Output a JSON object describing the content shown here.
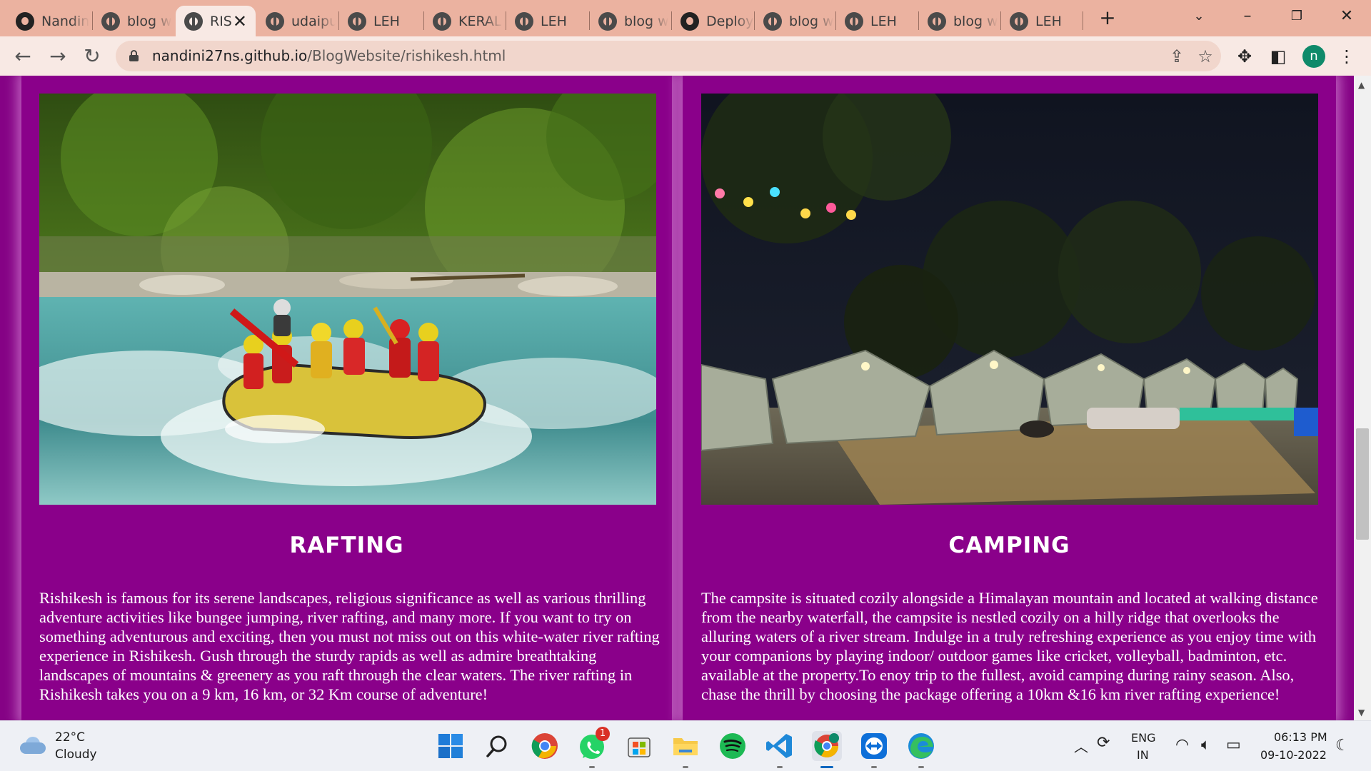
{
  "browser": {
    "tabs": [
      {
        "title": "Nandini",
        "icon": "github-icon"
      },
      {
        "title": "blog w",
        "icon": "globe-icon"
      },
      {
        "title": "RIS",
        "icon": "globe-icon",
        "active": true
      },
      {
        "title": "udaipu",
        "icon": "globe-icon"
      },
      {
        "title": "LEH",
        "icon": "globe-icon"
      },
      {
        "title": "KERAL",
        "icon": "globe-icon"
      },
      {
        "title": "LEH",
        "icon": "globe-icon"
      },
      {
        "title": "blog w",
        "icon": "globe-icon"
      },
      {
        "title": "Deploy",
        "icon": "github-icon"
      },
      {
        "title": "blog w",
        "icon": "globe-icon"
      },
      {
        "title": "LEH",
        "icon": "globe-icon"
      },
      {
        "title": "blog w",
        "icon": "globe-icon"
      },
      {
        "title": "LEH",
        "icon": "globe-icon"
      }
    ],
    "new_tab": "+",
    "url_host": "nandini27ns.github.io",
    "url_path": "/BlogWebsite/rishikesh.html",
    "profile_initial": "n",
    "colors": {
      "tabstrip": "#ebb2a0",
      "active_tab": "#f8e9e4",
      "omnibox": "#f1d6cc"
    }
  },
  "page": {
    "colors": {
      "background": "#850385",
      "card": "#8a008a",
      "glow": "#eca8ec"
    },
    "cards": [
      {
        "heading": "RAFTING",
        "text": "Rishikesh is famous for its serene landscapes, religious significance as well as various thrilling adventure activities like bungee jumping, river rafting, and many more. If you want to try on something adventurous and exciting, then you must not miss out on this white-water river rafting experience in Rishikesh. Gush through the sturdy rapids as well as admire breathtaking landscapes of mountains & greenery as you raft through the clear waters. The river rafting in Rishikesh takes you on a 9 km, 16 km, or 32 Km course of adventure!"
      },
      {
        "heading": "CAMPING",
        "text": "The campsite is situated cozily alongside a Himalayan mountain and located at walking distance from the nearby waterfall, the campsite is nestled cozily on a hilly ridge that overlooks the alluring waters of a river stream. Indulge in a truly refreshing experience as you enjoy time with your companions by playing indoor/ outdoor games like cricket, volleyball, badminton, etc. available at the property.To enoy trip to the fullest, avoid camping during rainy season. Also, chase the thrill by choosing the package offering a 10km &16 km river rafting experience!"
      }
    ]
  },
  "taskbar": {
    "weather_temp": "22°C",
    "weather_condition": "Cloudy",
    "whatsapp_badge": "1",
    "lang_line1": "ENG",
    "lang_line2": "IN",
    "time": "06:13 PM",
    "date": "09-10-2022"
  }
}
